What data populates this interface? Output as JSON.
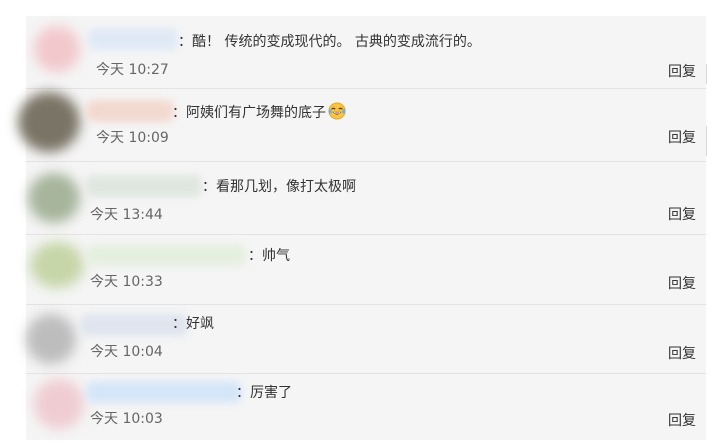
{
  "comments": [
    {
      "text": "：酷！ 传统的变成现代的。 古典的变成流行的。",
      "time": "今天 10:27",
      "reply": "回复",
      "avatar_color": "#f2c8cc",
      "name_color": "#dfe9f6"
    },
    {
      "text": "：阿姨们有广场舞的底子",
      "emoji_icon": "laughing-tears-icon",
      "time": "今天 10:09",
      "reply": "回复",
      "avatar_color": "#7a7466",
      "name_color": "#f2d9cf"
    },
    {
      "text": "：看那几划，像打太极啊",
      "time": "今天 13:44",
      "reply": "回复",
      "avatar_color": "#a7b59c",
      "name_color": "#dfe6df"
    },
    {
      "text": "：帅气",
      "time": "今天 10:33",
      "reply": "回复",
      "avatar_color": "#c6d6a8",
      "name_color": "#e5efe0"
    },
    {
      "text": "：好飒",
      "time": "今天 10:04",
      "reply": "回复",
      "avatar_color": "#bdbdbd",
      "name_color": "#dfe4ee"
    },
    {
      "text": "：厉害了",
      "time": "今天 10:03",
      "reply": "回复",
      "avatar_color": "#efccd2",
      "name_color": "#d5e6f9"
    }
  ]
}
